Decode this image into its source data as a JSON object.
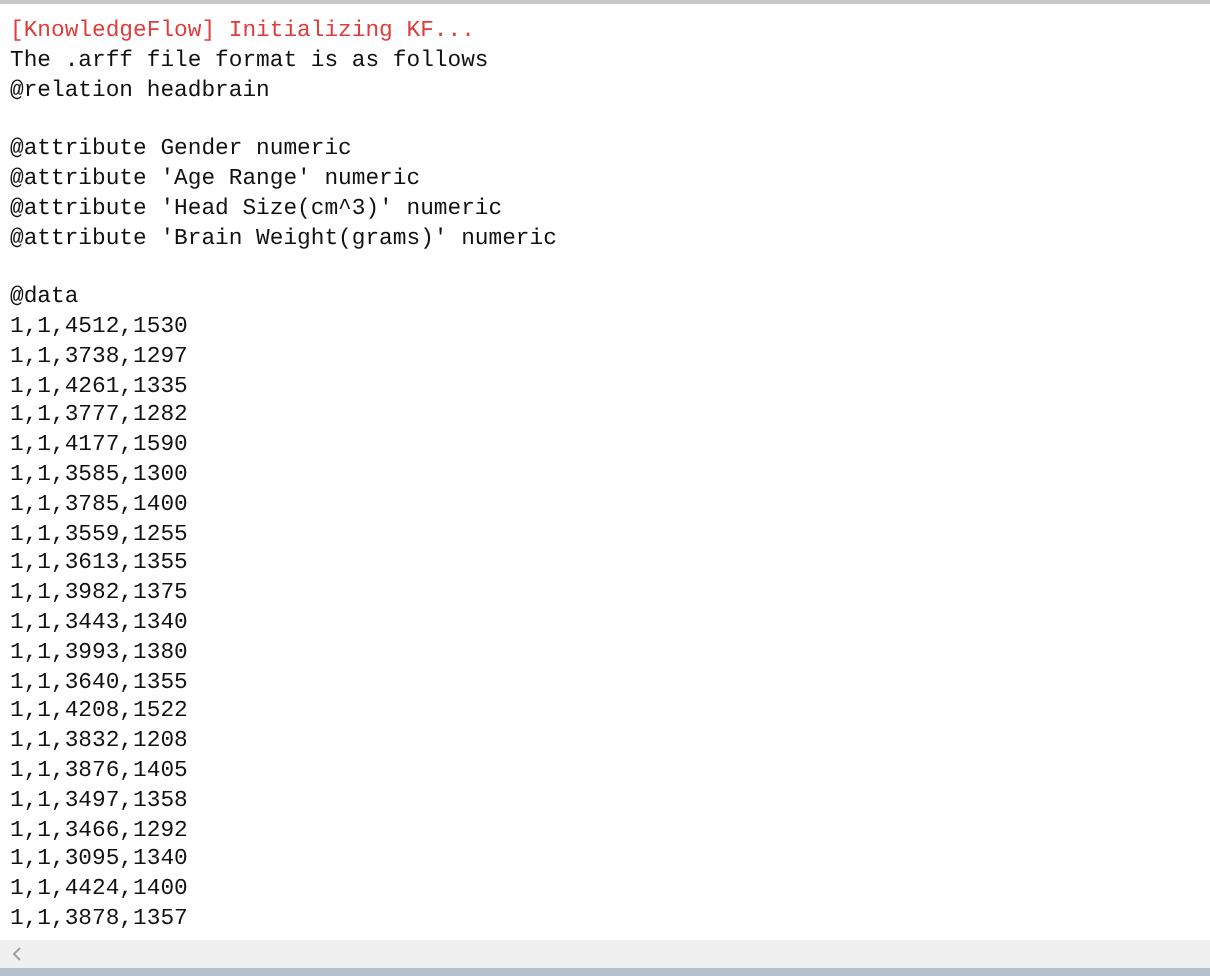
{
  "log_lines": [
    {
      "kind": "error",
      "text": "[KnowledgeFlow] Initializing KF..."
    },
    {
      "kind": "text",
      "text": "The .arff file format is as follows"
    },
    {
      "kind": "text",
      "text": "@relation headbrain"
    },
    {
      "kind": "blank"
    },
    {
      "kind": "text",
      "text": "@attribute Gender numeric"
    },
    {
      "kind": "text",
      "text": "@attribute 'Age Range' numeric"
    },
    {
      "kind": "text",
      "text": "@attribute 'Head Size(cm^3)' numeric"
    },
    {
      "kind": "text",
      "text": "@attribute 'Brain Weight(grams)' numeric"
    },
    {
      "kind": "blank"
    },
    {
      "kind": "text",
      "text": "@data"
    },
    {
      "kind": "text",
      "text": "1,1,4512,1530"
    },
    {
      "kind": "text",
      "text": "1,1,3738,1297"
    },
    {
      "kind": "text",
      "text": "1,1,4261,1335"
    },
    {
      "kind": "text",
      "text": "1,1,3777,1282"
    },
    {
      "kind": "text",
      "text": "1,1,4177,1590"
    },
    {
      "kind": "text",
      "text": "1,1,3585,1300"
    },
    {
      "kind": "text",
      "text": "1,1,3785,1400"
    },
    {
      "kind": "text",
      "text": "1,1,3559,1255"
    },
    {
      "kind": "text",
      "text": "1,1,3613,1355"
    },
    {
      "kind": "text",
      "text": "1,1,3982,1375"
    },
    {
      "kind": "text",
      "text": "1,1,3443,1340"
    },
    {
      "kind": "text",
      "text": "1,1,3993,1380"
    },
    {
      "kind": "text",
      "text": "1,1,3640,1355"
    },
    {
      "kind": "text",
      "text": "1,1,4208,1522"
    },
    {
      "kind": "text",
      "text": "1,1,3832,1208"
    },
    {
      "kind": "text",
      "text": "1,1,3876,1405"
    },
    {
      "kind": "text",
      "text": "1,1,3497,1358"
    },
    {
      "kind": "text",
      "text": "1,1,3466,1292"
    },
    {
      "kind": "text",
      "text": "1,1,3095,1340"
    },
    {
      "kind": "text",
      "text": "1,1,4424,1400"
    },
    {
      "kind": "text",
      "text": "1,1,3878,1357"
    }
  ]
}
